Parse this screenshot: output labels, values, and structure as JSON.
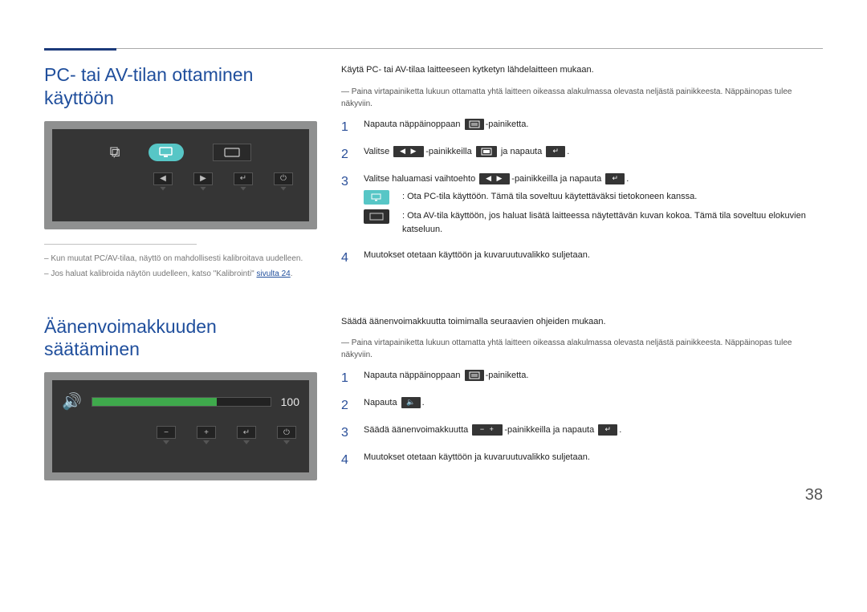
{
  "page_number": "38",
  "section1": {
    "title": "PC- tai AV-tilan ottaminen käyttöön",
    "note1": "Kun muutat PC/AV-tilaa, näyttö on mahdollisesti kalibroitava uudelleen.",
    "note2_prefix": "Jos haluat kalibroida näytön uudelleen, katso \"Kalibrointi\" ",
    "note2_link": "sivulta 24",
    "intro": "Käytä PC- tai AV-tilaa laitteeseen kytketyn lähdelaitteen mukaan.",
    "dash": "Paina virtapainiketta lukuun ottamatta yhtä laitteen oikeassa alakulmassa olevasta neljästä painikkeesta. Näppäinopas tulee näkyviin.",
    "step1_a": "Napauta näppäinoppaan ",
    "step1_b": "-painiketta.",
    "step2_a": "Valitse ",
    "step2_b": "-painikkeilla ",
    "step2_c": " ja napauta ",
    "step2_d": ".",
    "step3_a": "Valitse haluamasi vaihtoehto ",
    "step3_b": "-painikkeilla ja napauta ",
    "step3_c": ".",
    "opt1": ": Ota PC-tila käyttöön. Tämä tila soveltuu käytettäväksi tietokoneen kanssa.",
    "opt2": ": Ota AV-tila käyttöön, jos haluat lisätä laitteessa näytettävän kuvan kokoa. Tämä tila soveltuu elokuvien katseluun.",
    "step4": "Muutokset otetaan käyttöön ja kuvaruutuvalikko suljetaan."
  },
  "section2": {
    "title": "Äänenvoimakkuuden säätäminen",
    "vol_value": "100",
    "intro": "Säädä äänenvoimakkuutta toimimalla seuraavien ohjeiden mukaan.",
    "dash": "Paina virtapainiketta lukuun ottamatta yhtä laitteen oikeassa alakulmassa olevasta neljästä painikkeesta. Näppäinopas tulee näkyviin.",
    "step1_a": "Napauta näppäinoppaan ",
    "step1_b": "-painiketta.",
    "step2_a": "Napauta ",
    "step2_b": ".",
    "step3_a": "Säädä äänenvoimakkuutta ",
    "step3_b": "-painikkeilla ja napauta ",
    "step3_c": ".",
    "step4": "Muutokset otetaan käyttöön ja kuvaruutuvalikko suljetaan."
  }
}
